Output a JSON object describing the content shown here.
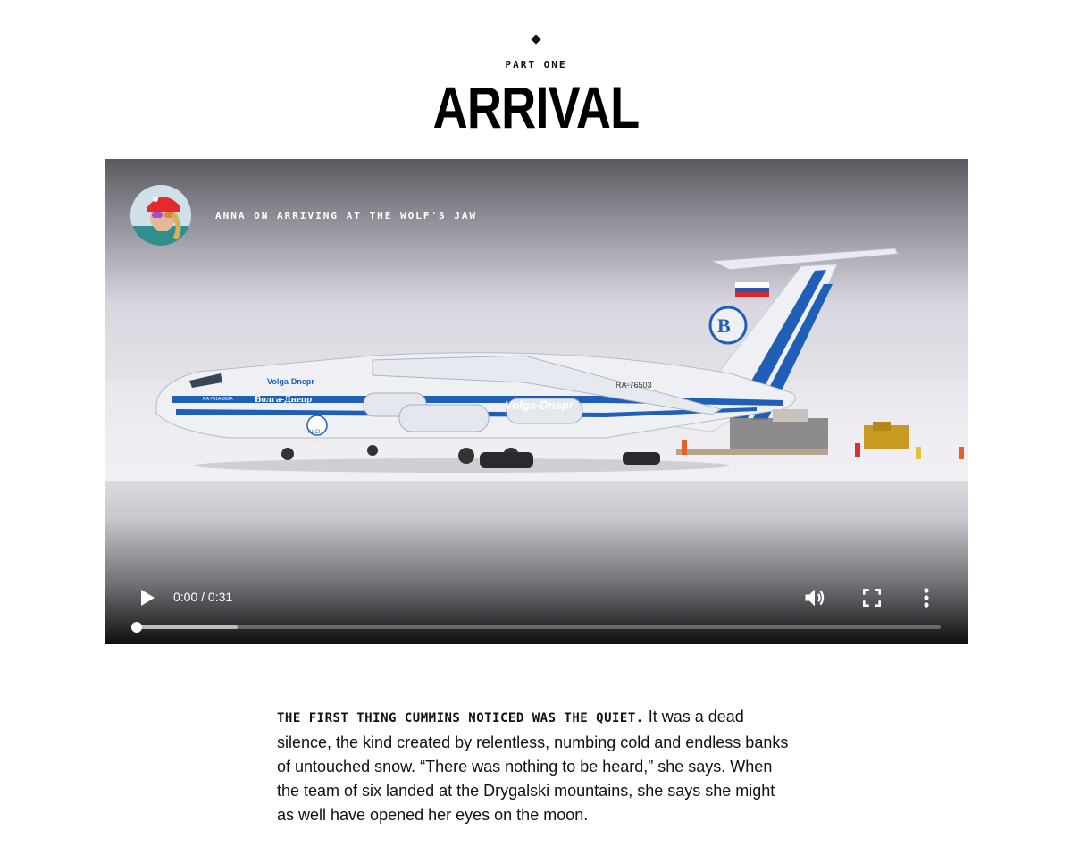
{
  "section": {
    "part_label": "PART ONE",
    "title": "ARRIVAL"
  },
  "video": {
    "caption": "ANNA ON ARRIVING AT THE WOLF'S JAW",
    "time_display": "0:00 / 0:31",
    "progress_fraction": 0.0,
    "buffered_fraction": 0.125,
    "aircraft_markings": {
      "nose_name": "Volga-Dnepr",
      "cyrillic_name": "Волга-Днепр",
      "fuselage_name": "Volga-Dnepr",
      "registration": "RA-76503",
      "nose_registration": "RA-761A-803A",
      "badge": "ALCI"
    },
    "icons": {
      "play": "play-icon",
      "volume": "volume-icon",
      "fullscreen": "fullscreen-icon",
      "more": "more-vert-icon"
    }
  },
  "article": {
    "lead": "THE FIRST THING CUMMINS NOTICED WAS THE QUIET.",
    "body": " It was a dead silence, the kind created by relentless, numbing cold and endless banks of untouched snow. “There was nothing to be heard,” she says. When the team of six landed at the Drygalski mountains, she says she might as well have opened her eyes on the moon."
  }
}
